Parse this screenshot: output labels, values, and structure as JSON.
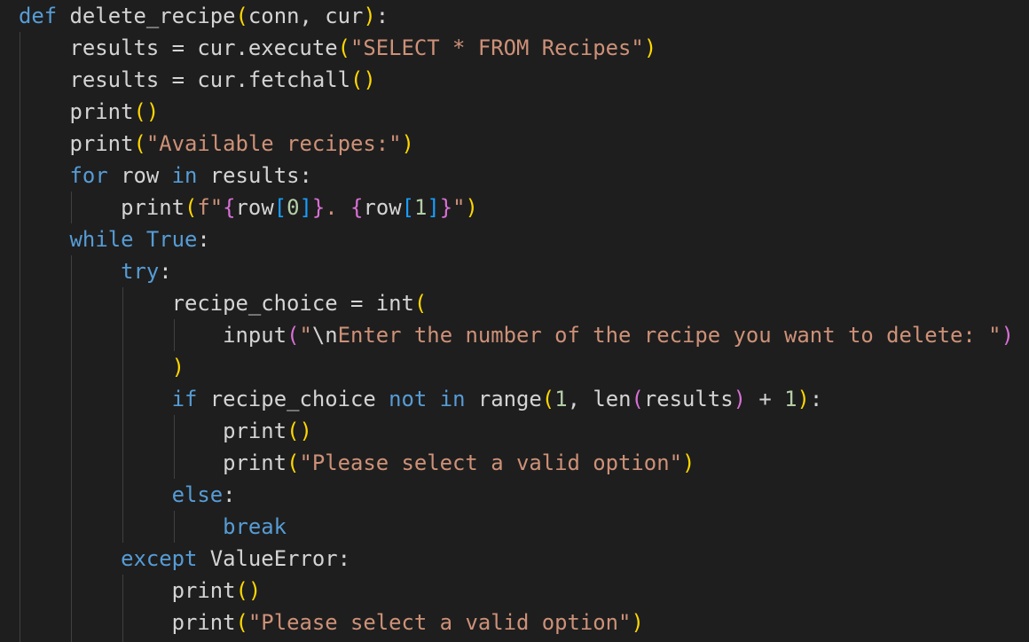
{
  "editor": {
    "language": "python",
    "theme_colors": {
      "background": "#1e1e1e",
      "text": "#d4d4d4",
      "keyword": "#569cd6",
      "control": "#c586c0",
      "string": "#ce9178",
      "number": "#b5cea8",
      "bracket_level_1": "#ffd700",
      "bracket_level_2": "#da70d6",
      "bracket_level_3": "#179fff",
      "indent_guide": "#404040"
    },
    "lines": [
      [
        {
          "t": "def",
          "c": "kw"
        },
        {
          "t": " delete_recipe",
          "c": "plain"
        },
        {
          "t": "(",
          "c": "b1"
        },
        {
          "t": "conn, cur",
          "c": "plain"
        },
        {
          "t": ")",
          "c": "b1"
        },
        {
          "t": ":",
          "c": "plain"
        }
      ],
      [
        {
          "t": "    results = cur.execute",
          "c": "plain"
        },
        {
          "t": "(",
          "c": "b1"
        },
        {
          "t": "\"SELECT * FROM Recipes\"",
          "c": "str"
        },
        {
          "t": ")",
          "c": "b1"
        }
      ],
      [
        {
          "t": "    results = cur.fetchall",
          "c": "plain"
        },
        {
          "t": "()",
          "c": "b1"
        }
      ],
      [
        {
          "t": "    print",
          "c": "plain"
        },
        {
          "t": "()",
          "c": "b1"
        }
      ],
      [
        {
          "t": "    print",
          "c": "plain"
        },
        {
          "t": "(",
          "c": "b1"
        },
        {
          "t": "\"Available recipes:\"",
          "c": "str"
        },
        {
          "t": ")",
          "c": "b1"
        }
      ],
      [
        {
          "t": "    ",
          "c": "plain"
        },
        {
          "t": "for",
          "c": "kw"
        },
        {
          "t": " row ",
          "c": "plain"
        },
        {
          "t": "in",
          "c": "kw"
        },
        {
          "t": " results:",
          "c": "plain"
        }
      ],
      [
        {
          "t": "        print",
          "c": "plain"
        },
        {
          "t": "(",
          "c": "b1"
        },
        {
          "t": "f\"",
          "c": "str"
        },
        {
          "t": "{",
          "c": "b2"
        },
        {
          "t": "row",
          "c": "plain"
        },
        {
          "t": "[",
          "c": "b3"
        },
        {
          "t": "0",
          "c": "num"
        },
        {
          "t": "]",
          "c": "b3"
        },
        {
          "t": "}",
          "c": "b2"
        },
        {
          "t": ". ",
          "c": "str"
        },
        {
          "t": "{",
          "c": "b2"
        },
        {
          "t": "row",
          "c": "plain"
        },
        {
          "t": "[",
          "c": "b3"
        },
        {
          "t": "1",
          "c": "num"
        },
        {
          "t": "]",
          "c": "b3"
        },
        {
          "t": "}",
          "c": "b2"
        },
        {
          "t": "\"",
          "c": "str"
        },
        {
          "t": ")",
          "c": "b1"
        }
      ],
      [
        {
          "t": "    ",
          "c": "plain"
        },
        {
          "t": "while",
          "c": "kw"
        },
        {
          "t": " ",
          "c": "plain"
        },
        {
          "t": "True",
          "c": "kw"
        },
        {
          "t": ":",
          "c": "plain"
        }
      ],
      [
        {
          "t": "        ",
          "c": "plain"
        },
        {
          "t": "try",
          "c": "kw"
        },
        {
          "t": ":",
          "c": "plain"
        }
      ],
      [
        {
          "t": "            recipe_choice = int",
          "c": "plain"
        },
        {
          "t": "(",
          "c": "b1"
        }
      ],
      [
        {
          "t": "                input",
          "c": "plain"
        },
        {
          "t": "(",
          "c": "b2"
        },
        {
          "t": "\"",
          "c": "str"
        },
        {
          "t": "\\n",
          "c": "plain"
        },
        {
          "t": "Enter the number of the recipe you want to delete: \"",
          "c": "str"
        },
        {
          "t": ")",
          "c": "b2"
        }
      ],
      [
        {
          "t": "            ",
          "c": "plain"
        },
        {
          "t": ")",
          "c": "b1"
        }
      ],
      [
        {
          "t": "            ",
          "c": "plain"
        },
        {
          "t": "if",
          "c": "kw"
        },
        {
          "t": " recipe_choice ",
          "c": "plain"
        },
        {
          "t": "not",
          "c": "kw"
        },
        {
          "t": " ",
          "c": "plain"
        },
        {
          "t": "in",
          "c": "kw"
        },
        {
          "t": " range",
          "c": "plain"
        },
        {
          "t": "(",
          "c": "b1"
        },
        {
          "t": "1",
          "c": "num"
        },
        {
          "t": ", len",
          "c": "plain"
        },
        {
          "t": "(",
          "c": "b2"
        },
        {
          "t": "results",
          "c": "plain"
        },
        {
          "t": ")",
          "c": "b2"
        },
        {
          "t": " + ",
          "c": "plain"
        },
        {
          "t": "1",
          "c": "num"
        },
        {
          "t": ")",
          "c": "b1"
        },
        {
          "t": ":",
          "c": "plain"
        }
      ],
      [
        {
          "t": "                print",
          "c": "plain"
        },
        {
          "t": "()",
          "c": "b1"
        }
      ],
      [
        {
          "t": "                print",
          "c": "plain"
        },
        {
          "t": "(",
          "c": "b1"
        },
        {
          "t": "\"Please select a valid option\"",
          "c": "str"
        },
        {
          "t": ")",
          "c": "b1"
        }
      ],
      [
        {
          "t": "            ",
          "c": "plain"
        },
        {
          "t": "else",
          "c": "kw"
        },
        {
          "t": ":",
          "c": "plain"
        }
      ],
      [
        {
          "t": "                ",
          "c": "plain"
        },
        {
          "t": "break",
          "c": "kw"
        }
      ],
      [
        {
          "t": "        ",
          "c": "plain"
        },
        {
          "t": "except",
          "c": "kw"
        },
        {
          "t": " ValueError:",
          "c": "plain"
        }
      ],
      [
        {
          "t": "            print",
          "c": "plain"
        },
        {
          "t": "()",
          "c": "b1"
        }
      ],
      [
        {
          "t": "            print",
          "c": "plain"
        },
        {
          "t": "(",
          "c": "b1"
        },
        {
          "t": "\"Please select a valid option\"",
          "c": "str"
        },
        {
          "t": ")",
          "c": "b1"
        }
      ]
    ]
  }
}
